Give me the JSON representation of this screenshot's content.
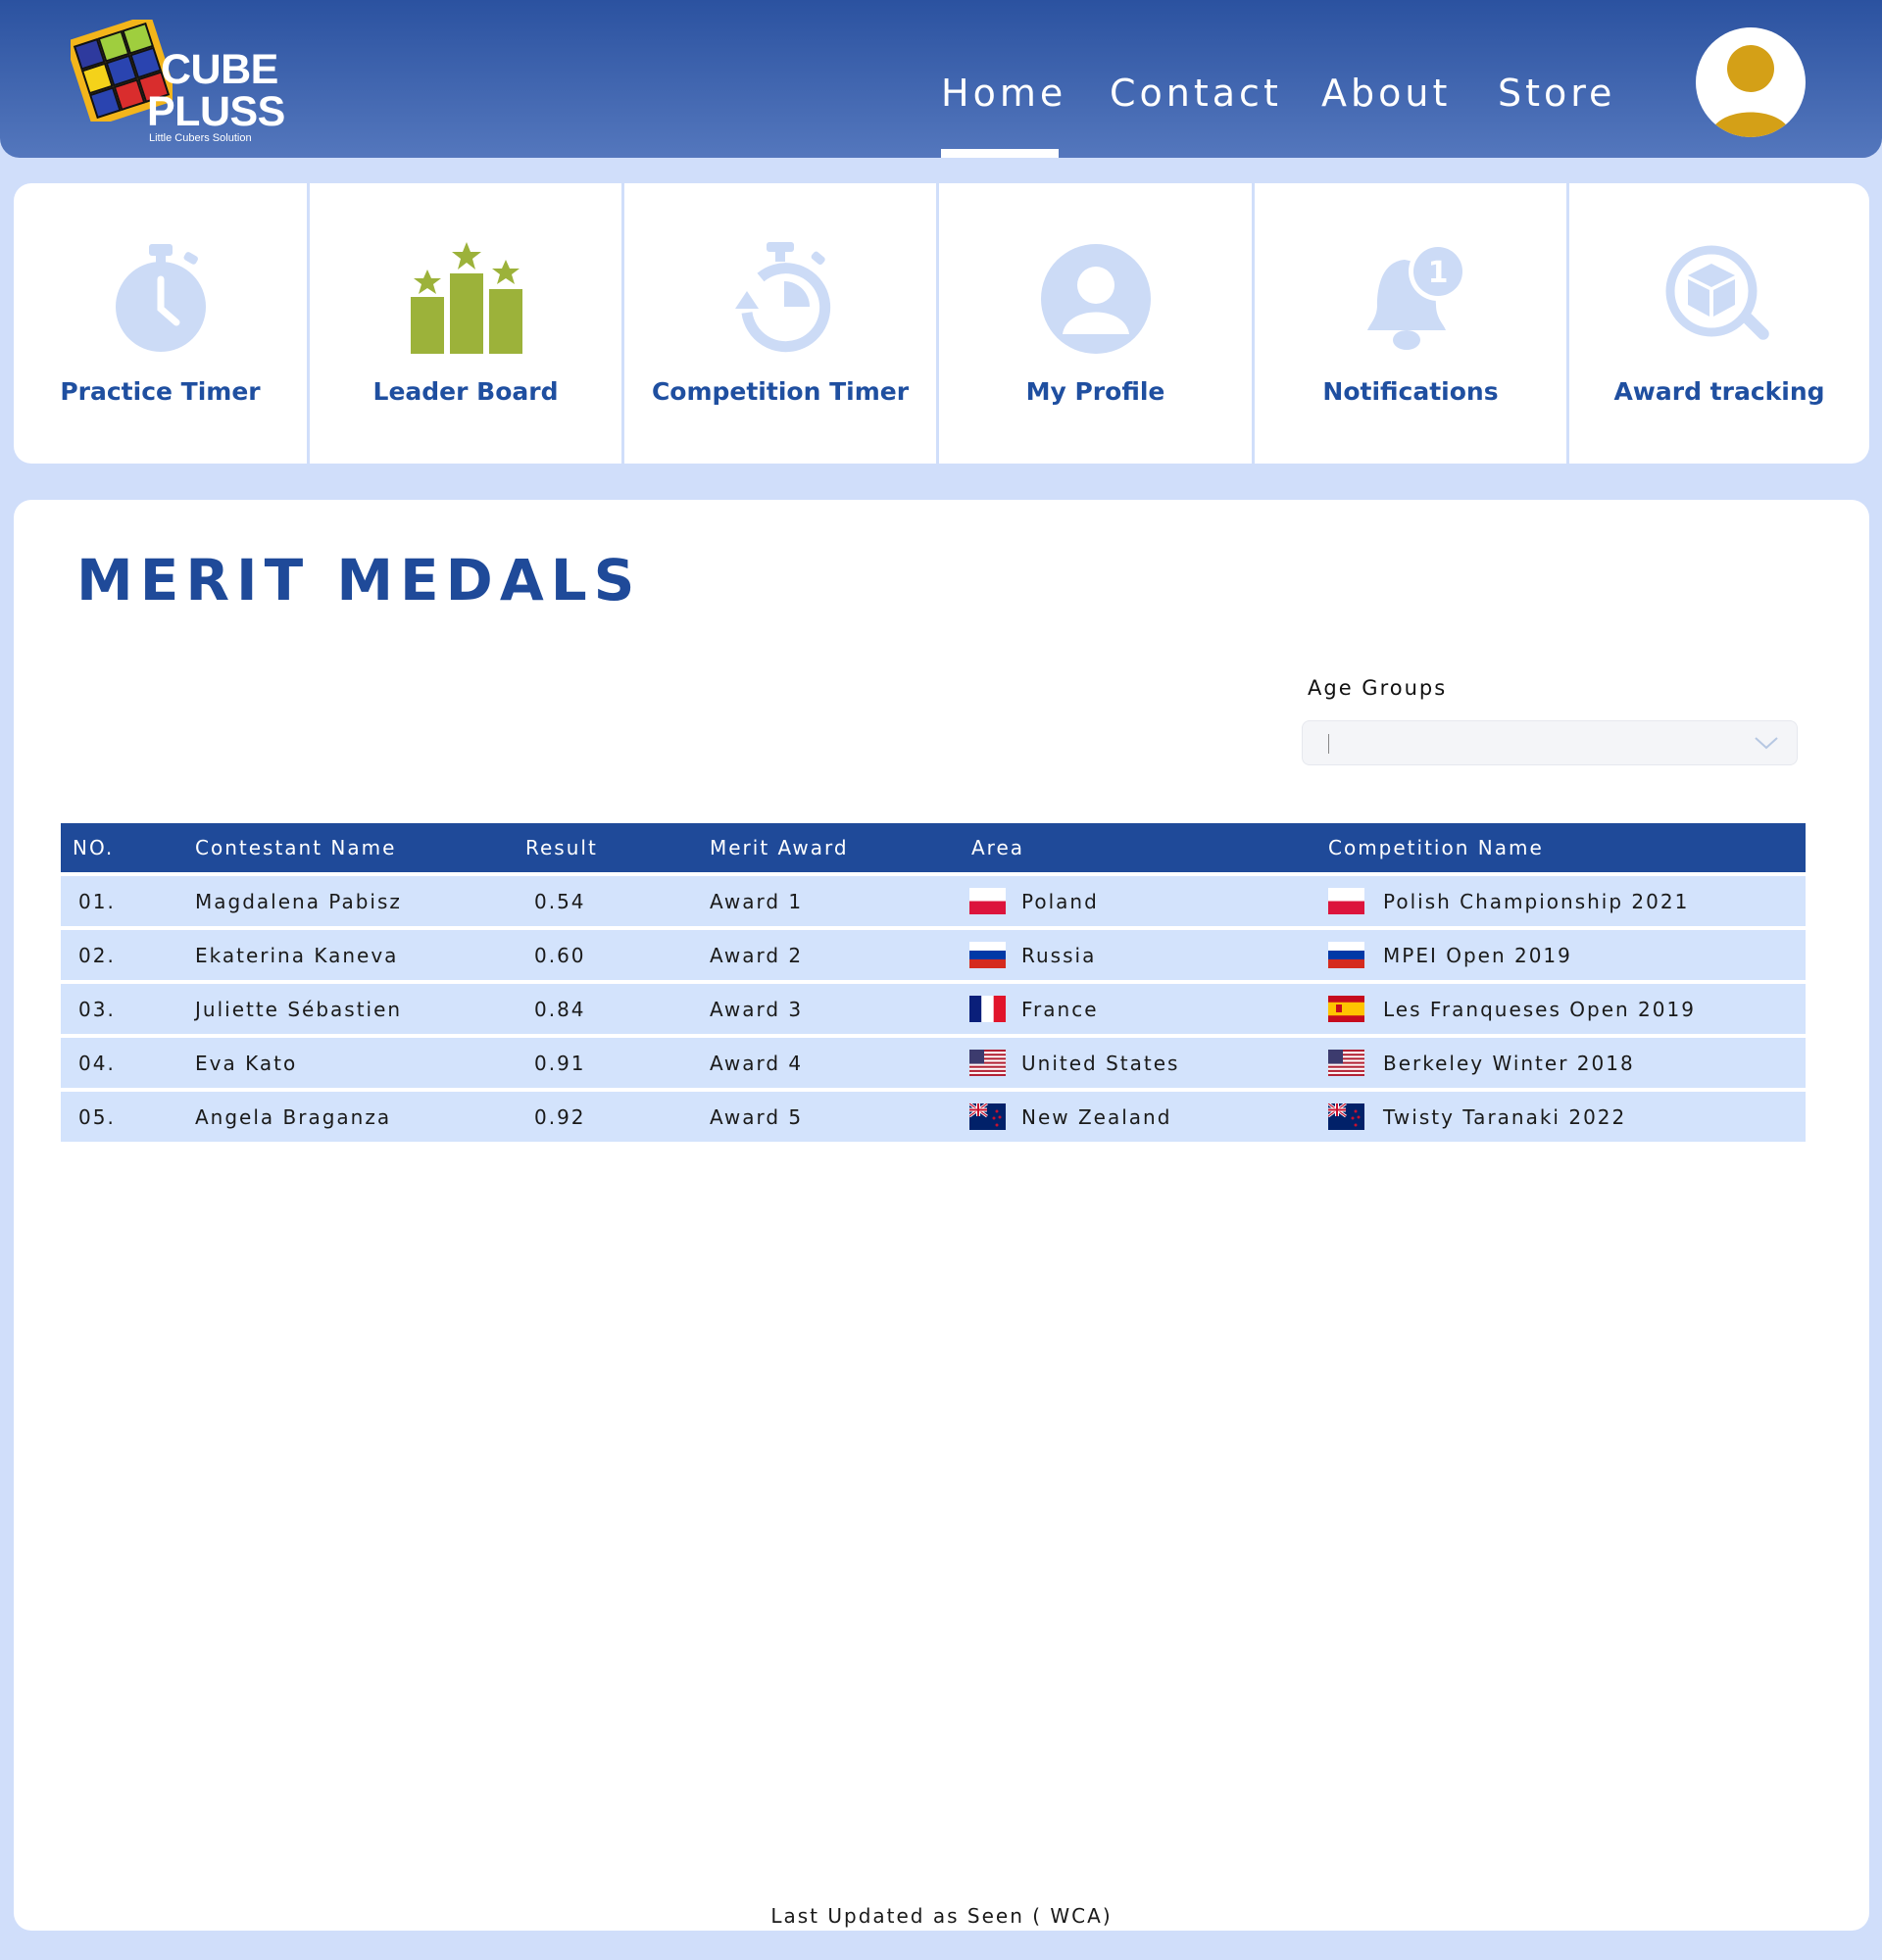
{
  "brand": {
    "name_line1": "CUBE",
    "name_line2": "PLUSS",
    "tagline": "Little Cubers Solution"
  },
  "nav": {
    "items": [
      {
        "label": "Home",
        "active": true
      },
      {
        "label": "Contact",
        "active": false
      },
      {
        "label": "About",
        "active": false
      },
      {
        "label": "Store",
        "active": false
      }
    ],
    "avatar_icon": "user-avatar-icon"
  },
  "quick_nav": [
    {
      "label": "Practice Timer",
      "icon": "stopwatch-icon"
    },
    {
      "label": "Leader Board",
      "icon": "podium-stars-icon"
    },
    {
      "label": "Competition Timer",
      "icon": "timer-reset-icon"
    },
    {
      "label": "My Profile",
      "icon": "user-circle-icon"
    },
    {
      "label": "Notifications",
      "icon": "bell-badge-icon"
    },
    {
      "label": "Award tracking",
      "icon": "cube-search-icon"
    }
  ],
  "notifications_badge": "1",
  "main": {
    "title": "MERIT MEDALS",
    "filter": {
      "label": "Age Groups",
      "value": ""
    },
    "table": {
      "headers": [
        "NO.",
        "Contestant Name",
        "Result",
        "Merit Award",
        "Area",
        "Competition Name"
      ],
      "rows": [
        {
          "no": "01.",
          "name": "Magdalena Pabisz",
          "result": "0.54",
          "award": "Award 1",
          "area": "Poland",
          "area_flag": "poland",
          "competition": "Polish Championship 2021",
          "competition_flag": "poland"
        },
        {
          "no": "02.",
          "name": "Ekaterina Kaneva",
          "result": "0.60",
          "award": "Award 2",
          "area": "Russia",
          "area_flag": "russia",
          "competition": "MPEI Open 2019",
          "competition_flag": "russia"
        },
        {
          "no": "03.",
          "name": "Juliette Sébastien",
          "result": "0.84",
          "award": "Award 3",
          "area": "France",
          "area_flag": "france",
          "competition": "Les Franqueses Open 2019",
          "competition_flag": "spain"
        },
        {
          "no": "04.",
          "name": "Eva Kato",
          "result": "0.91",
          "award": "Award 4",
          "area": "United States",
          "area_flag": "usa",
          "competition": "Berkeley Winter 2018",
          "competition_flag": "usa"
        },
        {
          "no": "05.",
          "name": "Angela Braganza",
          "result": "0.92",
          "award": "Award 5",
          "area": "New Zealand",
          "area_flag": "new-zealand",
          "competition": "Twisty Taranaki 2022",
          "competition_flag": "new-zealand"
        }
      ]
    },
    "footer": "Last Updated as Seen ( WCA)"
  },
  "colors": {
    "header_top": "#2b52a0",
    "header_bottom": "#5477bd",
    "page_bg": "#d0defa",
    "title_blue": "#1f4a99",
    "table_header": "#1f4a99",
    "row_bg": "#d3e3fc",
    "icon_light": "#ccdbf6",
    "icon_green": "#9cb23a",
    "avatar_gold": "#d4a017"
  }
}
